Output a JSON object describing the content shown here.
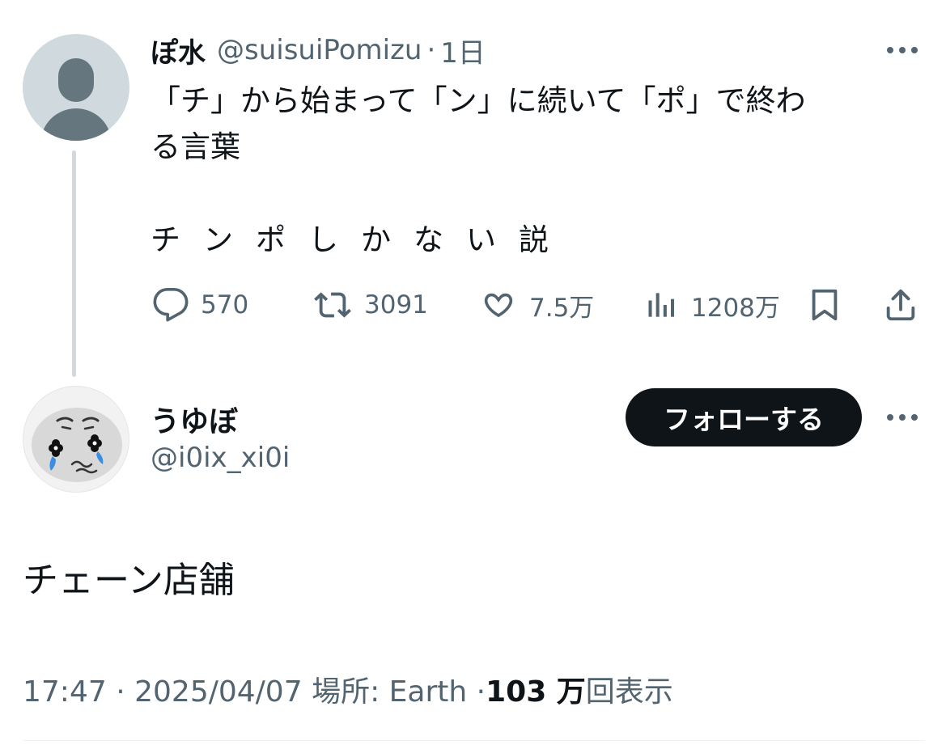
{
  "parent_tweet": {
    "display_name": "ぽ水",
    "handle": "@suisuiPomizu",
    "separator": "·",
    "time_ago": "1日",
    "text_line1": "「チ」から始まって「ン」に続いて「ポ」で終わ\nる言葉",
    "text_line2": "チンポしかない説",
    "avatar_icon": "default-avatar-icon",
    "actions": {
      "reply_count": "570",
      "retweet_count": "3091",
      "like_count": "7.5万",
      "view_count": "1208万"
    }
  },
  "reply_tweet": {
    "display_name": "うゆぼ",
    "handle": "@i0ix_xi0i",
    "follow_label": "フォローする",
    "text": "チェーン店舗",
    "avatar_icon": "crying-face-avatar-icon",
    "meta": {
      "time": "17:47",
      "separator": "·",
      "date": "2025/04/07",
      "location": "場所: Earth",
      "views_number": "103 万",
      "views_suffix": "回表示"
    }
  },
  "colors": {
    "text_primary": "#0f1419",
    "text_secondary": "#536471",
    "thread_line": "#cfd9de",
    "follow_button_bg": "#0f1419"
  }
}
